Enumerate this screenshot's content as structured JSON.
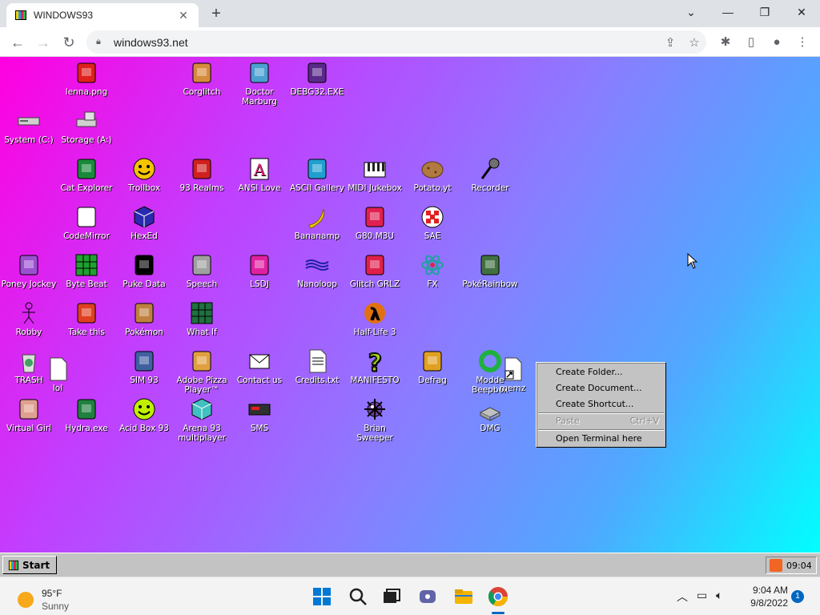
{
  "browser": {
    "tab_title": "WINDOWS93",
    "url": "windows93.net",
    "new_tab_label": "+",
    "close_tab_label": "✕"
  },
  "desktop_icons": [
    {
      "label": "lenna.png",
      "icon": "image-icon",
      "color": "#e0201c"
    },
    {
      "label": "Corglitch",
      "icon": "corgi-icon",
      "color": "#d68a3c"
    },
    {
      "label": "Doctor Marburg",
      "icon": "doctor-icon",
      "color": "#4aa0d0"
    },
    {
      "label": "DEBG32.EXE",
      "icon": "computer-face-icon",
      "color": "#5a2a8a"
    },
    {
      "label": "System (C:)",
      "icon": "drive-icon",
      "color": "#c0c0c0"
    },
    {
      "label": "Storage (A:)",
      "icon": "floppy-drive-icon",
      "color": "#c0c0c0"
    },
    {
      "label": "Cat Explorer",
      "icon": "globe-cat-icon",
      "color": "#1a8a3a"
    },
    {
      "label": "Trollbox",
      "icon": "chat-smiley-icon",
      "color": "#f4c400"
    },
    {
      "label": "93 Realms",
      "icon": "dragon-icon",
      "color": "#d02020"
    },
    {
      "label": "ANSI Love",
      "icon": "letter-a-icon",
      "color": "#e0207a"
    },
    {
      "label": "ASCII Gallery",
      "icon": "numbers-icon",
      "color": "#20a0d0"
    },
    {
      "label": "MIDI Jukebox",
      "icon": "piano-icon",
      "color": "#222222"
    },
    {
      "label": "Potato.yt",
      "icon": "potato-icon",
      "color": "#b07a40"
    },
    {
      "label": "Recorder",
      "icon": "microphone-icon",
      "color": "#707070"
    },
    {
      "label": "CodeMirror",
      "icon": "rabbit-icon",
      "color": "#ffffff"
    },
    {
      "label": "HexEd",
      "icon": "cube-icon",
      "color": "#2a2ab0"
    },
    {
      "label": "Bananamp",
      "icon": "banana-icon",
      "color": "#f4d000"
    },
    {
      "label": "G80.M3U",
      "icon": "audio-file-icon",
      "color": "#e02050"
    },
    {
      "label": "SAE",
      "icon": "checkered-ball-icon",
      "color": "#e02020"
    },
    {
      "label": "Poney Jockey",
      "icon": "pony-icon",
      "color": "#9a50d0"
    },
    {
      "label": "Byte Beat",
      "icon": "bytebeat-icon",
      "color": "#20a030"
    },
    {
      "label": "Puke Data",
      "icon": "pd-icon",
      "color": "#000000"
    },
    {
      "label": "Speech",
      "icon": "face-icon",
      "color": "#a0a0a0"
    },
    {
      "label": "LSDJ",
      "icon": "gameboy-icon",
      "color": "#e020a0"
    },
    {
      "label": "Nanoloop",
      "icon": "waves-icon",
      "color": "#2020a0"
    },
    {
      "label": "Glitch GRLZ",
      "icon": "lips-icon",
      "color": "#e0204a"
    },
    {
      "label": "FX",
      "icon": "atom-icon",
      "color": "#20a0a0"
    },
    {
      "label": "PokéRainbow",
      "icon": "trainers-icon",
      "color": "#407040"
    },
    {
      "label": "Robby",
      "icon": "stick-figure-icon",
      "color": "#000000"
    },
    {
      "label": "Take this",
      "icon": "hero-icon",
      "color": "#e04020"
    },
    {
      "label": "Pokémon",
      "icon": "pokemon-icon",
      "color": "#c08040"
    },
    {
      "label": "What If",
      "icon": "grid-icon",
      "color": "#207040"
    },
    {
      "label": "Half-Life 3",
      "icon": "lambda-icon",
      "color": "#e07010"
    },
    {
      "label": "TRASH",
      "icon": "trash-icon",
      "color": "#40a060"
    },
    {
      "label": "lol",
      "icon": "blank-file-icon",
      "color": "#ffffff"
    },
    {
      "label": "SIM 93",
      "icon": "book-icon",
      "color": "#4060a0"
    },
    {
      "label": "Adobe Pizza Player™",
      "icon": "pizza-icon",
      "color": "#e0a040"
    },
    {
      "label": "Contact us",
      "icon": "mail-icon",
      "color": "#ffffff"
    },
    {
      "label": "Credits.txt",
      "icon": "text-file-icon",
      "color": "#ffffff"
    },
    {
      "label": "MANIFESTO",
      "icon": "question-icon",
      "color": "#a0d020"
    },
    {
      "label": "Defrag",
      "icon": "defrag-icon",
      "color": "#e0a020"
    },
    {
      "label": "Modde Beepbox",
      "icon": "ring-icon",
      "color": "#20b040"
    },
    {
      "label": "memz",
      "icon": "shortcut-file-icon",
      "color": "#ffffff"
    },
    {
      "label": "Virtual Girl",
      "icon": "girl-icon",
      "color": "#e0a090"
    },
    {
      "label": "Hydra.exe",
      "icon": "hydra-icon",
      "color": "#208040"
    },
    {
      "label": "Acid Box 93",
      "icon": "acid-smiley-icon",
      "color": "#c0f000"
    },
    {
      "label": "Arena 93 multiplayer",
      "icon": "arena-cube-icon",
      "color": "#40c0c0"
    },
    {
      "label": "SMS",
      "icon": "console-icon",
      "color": "#303030"
    },
    {
      "label": "Brian Sweeper",
      "icon": "mine-icon",
      "color": "#7040a0"
    },
    {
      "label": "DMG",
      "icon": "disk-image-icon",
      "color": "#c0c0c0"
    }
  ],
  "context_menu": {
    "items": [
      {
        "label": "Create Folder...",
        "enabled": true
      },
      {
        "label": "Create Document...",
        "enabled": true
      },
      {
        "label": "Create Shortcut...",
        "enabled": true
      },
      {
        "label": "Paste",
        "shortcut": "Ctrl+V",
        "enabled": false
      },
      {
        "label": "Open Terminal here",
        "enabled": true
      }
    ]
  },
  "win93_taskbar": {
    "start_label": "Start",
    "clock": "09:04"
  },
  "windows_taskbar": {
    "weather_temp": "95°F",
    "weather_cond": "Sunny",
    "time": "9:04 AM",
    "date": "9/8/2022",
    "notifications": "1"
  },
  "colors": {
    "accent": "#0067c0",
    "win93_gray": "#c3c3c3"
  }
}
